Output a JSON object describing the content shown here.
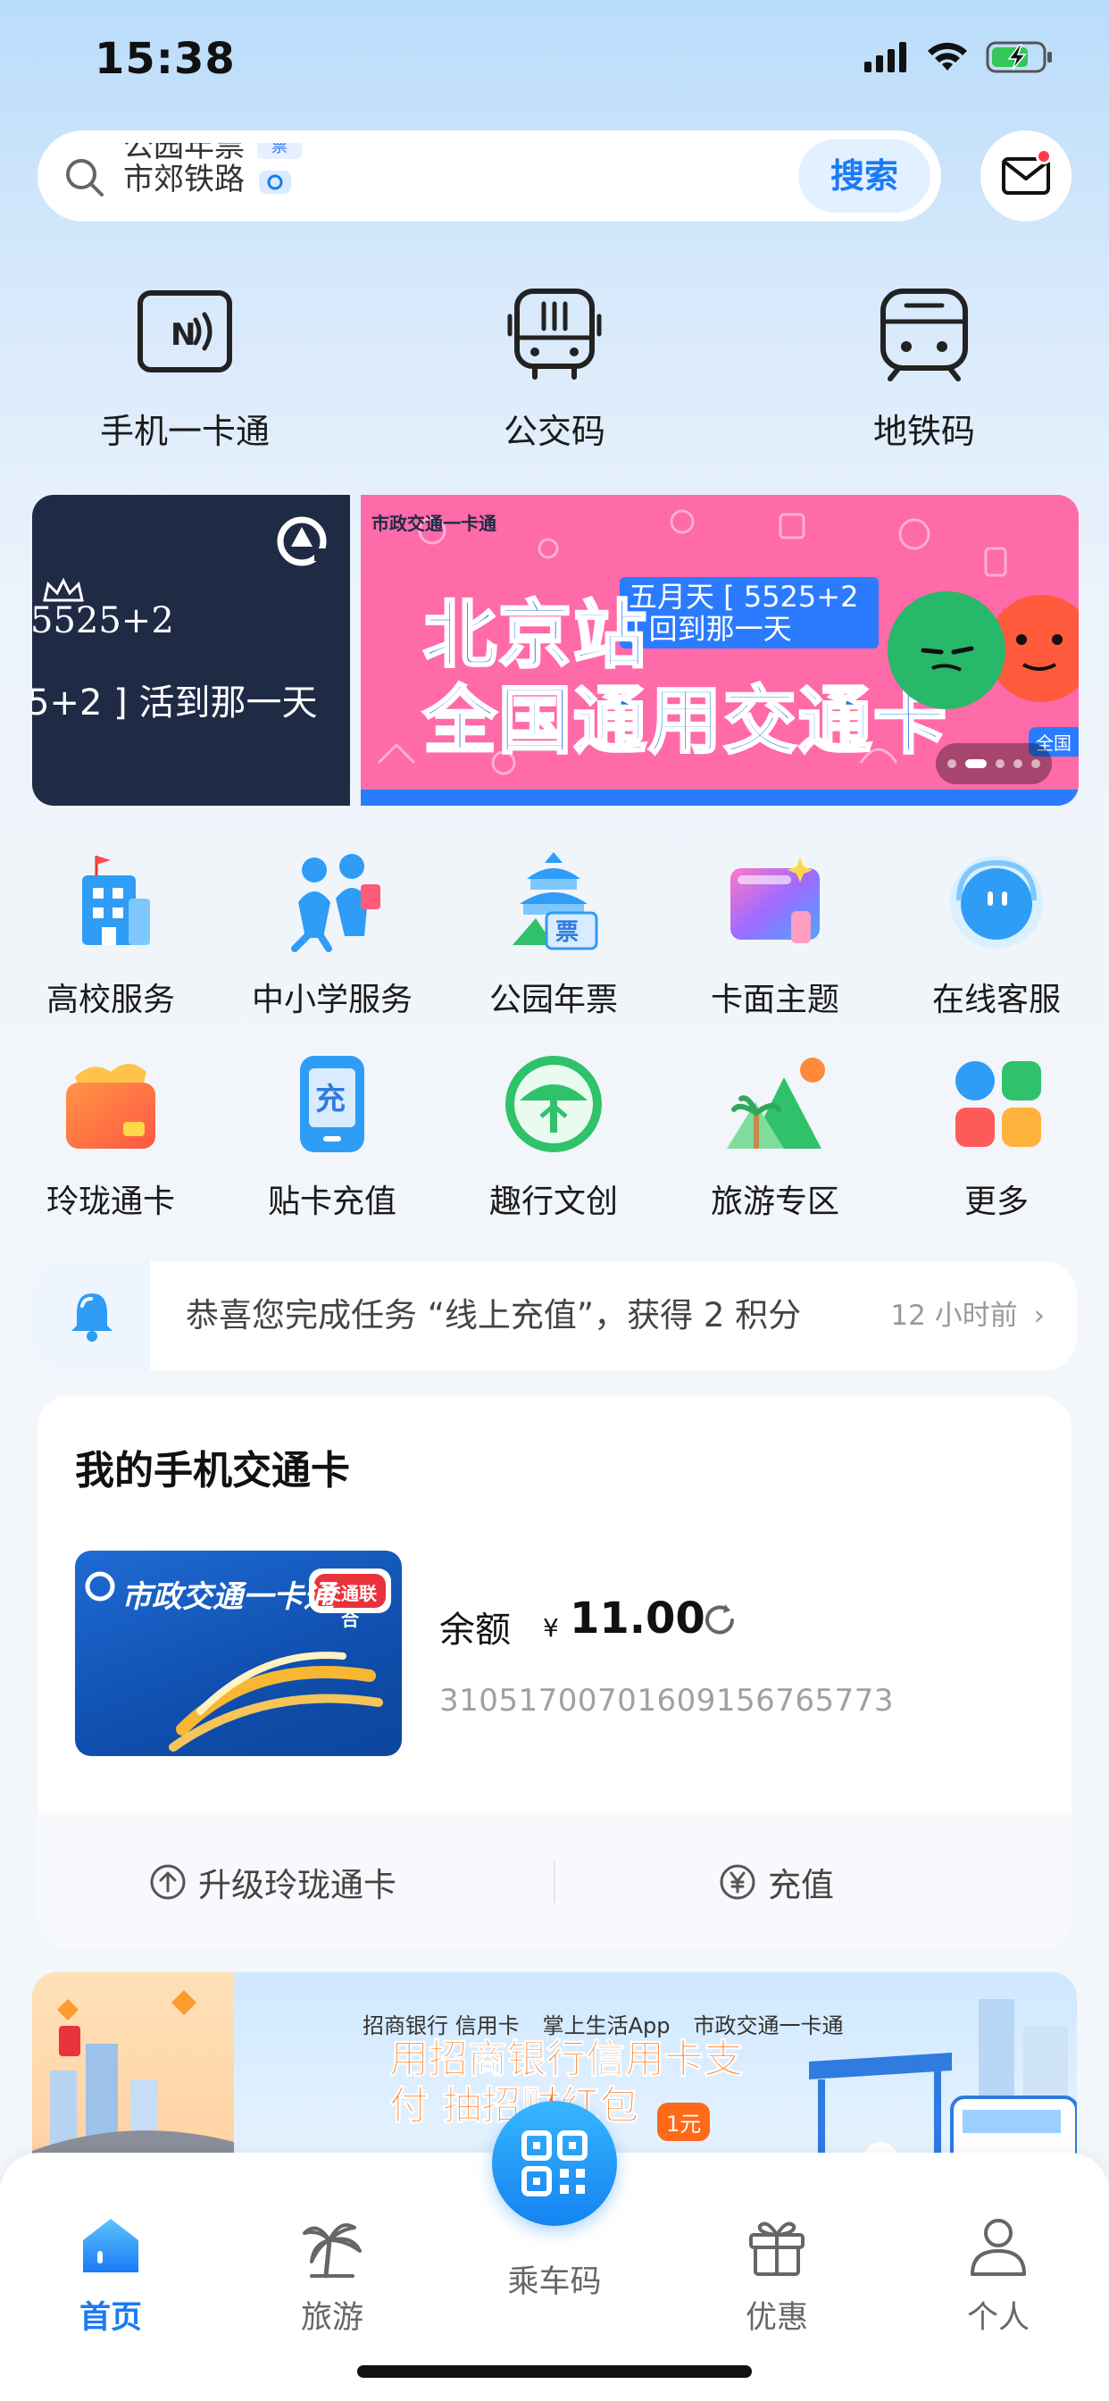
{
  "status_bar": {
    "time": "15:38"
  },
  "search": {
    "ticker": [
      {
        "text": "公园年票",
        "badge": "票"
      },
      {
        "text": "市郊铁路",
        "badge": ""
      }
    ],
    "button_label": "搜索"
  },
  "quick_actions": [
    {
      "label": "手机一卡通",
      "icon": "nfc-card-icon"
    },
    {
      "label": "公交码",
      "icon": "bus-icon"
    },
    {
      "label": "地铁码",
      "icon": "metro-icon"
    }
  ],
  "banner": {
    "left_text": "5+2 ] 活到那一天",
    "left_num": "5525+2",
    "brand": "市政交通一卡通",
    "sub": "五月天 [ 5525+2 ] 回到那一天",
    "title_line1": "北京站",
    "title_line2": "全国通用交通卡",
    "corner_tag": "全国",
    "slides": 5,
    "active_slide": 2
  },
  "services": [
    {
      "label": "高校服务",
      "icon": "university-icon"
    },
    {
      "label": "中小学服务",
      "icon": "students-icon"
    },
    {
      "label": "公园年票",
      "icon": "park-ticket-icon"
    },
    {
      "label": "卡面主题",
      "icon": "card-theme-icon"
    },
    {
      "label": "在线客服",
      "icon": "customer-service-icon"
    },
    {
      "label": "玲珑通卡",
      "icon": "linglong-card-icon"
    },
    {
      "label": "贴卡充值",
      "icon": "card-recharge-icon"
    },
    {
      "label": "趣行文创",
      "icon": "cultural-creative-icon"
    },
    {
      "label": "旅游专区",
      "icon": "travel-zone-icon"
    },
    {
      "label": "更多",
      "icon": "more-apps-icon"
    }
  ],
  "notice": {
    "text": "恭喜您完成任务 “线上充值”，获得 2 积分",
    "time": "12 小时前"
  },
  "my_card": {
    "title": "我的手机交通卡",
    "card_brand": "市政交通一卡通",
    "card_badge": "交通联合",
    "balance_label": "余额",
    "currency": "¥",
    "balance": "11.00",
    "card_number": "31051700701609156765773",
    "upgrade_label": "升级玲珑通卡",
    "recharge_label": "充值"
  },
  "promo": {
    "brands": [
      "招商银行 信用卡",
      "掌上生活App",
      "市政交通一卡通"
    ],
    "title": "用招商银行信用卡支付 抽招财红包",
    "badge": "1元"
  },
  "tabbar": {
    "items": [
      {
        "label": "首页",
        "active": true
      },
      {
        "label": "旅游",
        "active": false
      },
      {
        "label": "乘车码",
        "active": false
      },
      {
        "label": "优惠",
        "active": false
      },
      {
        "label": "个人",
        "active": false
      }
    ]
  },
  "colors": {
    "accent": "#1b7af5",
    "background_top": "#b9dcfb",
    "banner_pink": "#ff67a6",
    "banner_left": "#1f2a45",
    "card_blue": "#1f6bd4"
  }
}
